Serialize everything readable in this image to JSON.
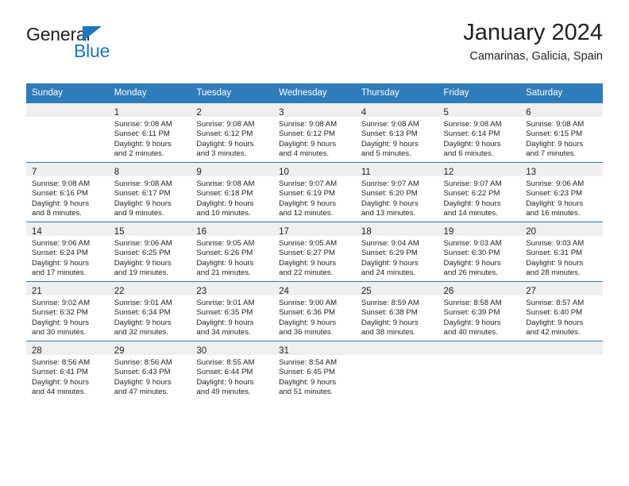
{
  "logo": {
    "word_one": "General",
    "word_two": "Blue",
    "triangle_icon": "blue-triangle-icon",
    "blue_hex": "#1f76bd"
  },
  "header": {
    "title": "January 2024",
    "subtitle": "Camarinas, Galicia, Spain"
  },
  "theme": {
    "header_blue": "#2e7cba",
    "daynum_band": "#efefef",
    "text": "#231f20"
  },
  "calendar": {
    "weekday_headers": [
      "Sunday",
      "Monday",
      "Tuesday",
      "Wednesday",
      "Thursday",
      "Friday",
      "Saturday"
    ],
    "weeks": [
      [
        {
          "day": "",
          "lines": []
        },
        {
          "day": "1",
          "lines": [
            "Sunrise: 9:08 AM",
            "Sunset: 6:11 PM",
            "Daylight: 9 hours",
            "and 2 minutes."
          ]
        },
        {
          "day": "2",
          "lines": [
            "Sunrise: 9:08 AM",
            "Sunset: 6:12 PM",
            "Daylight: 9 hours",
            "and 3 minutes."
          ]
        },
        {
          "day": "3",
          "lines": [
            "Sunrise: 9:08 AM",
            "Sunset: 6:12 PM",
            "Daylight: 9 hours",
            "and 4 minutes."
          ]
        },
        {
          "day": "4",
          "lines": [
            "Sunrise: 9:08 AM",
            "Sunset: 6:13 PM",
            "Daylight: 9 hours",
            "and 5 minutes."
          ]
        },
        {
          "day": "5",
          "lines": [
            "Sunrise: 9:08 AM",
            "Sunset: 6:14 PM",
            "Daylight: 9 hours",
            "and 6 minutes."
          ]
        },
        {
          "day": "6",
          "lines": [
            "Sunrise: 9:08 AM",
            "Sunset: 6:15 PM",
            "Daylight: 9 hours",
            "and 7 minutes."
          ]
        }
      ],
      [
        {
          "day": "7",
          "lines": [
            "Sunrise: 9:08 AM",
            "Sunset: 6:16 PM",
            "Daylight: 9 hours",
            "and 8 minutes."
          ]
        },
        {
          "day": "8",
          "lines": [
            "Sunrise: 9:08 AM",
            "Sunset: 6:17 PM",
            "Daylight: 9 hours",
            "and 9 minutes."
          ]
        },
        {
          "day": "9",
          "lines": [
            "Sunrise: 9:08 AM",
            "Sunset: 6:18 PM",
            "Daylight: 9 hours",
            "and 10 minutes."
          ]
        },
        {
          "day": "10",
          "lines": [
            "Sunrise: 9:07 AM",
            "Sunset: 6:19 PM",
            "Daylight: 9 hours",
            "and 12 minutes."
          ]
        },
        {
          "day": "11",
          "lines": [
            "Sunrise: 9:07 AM",
            "Sunset: 6:20 PM",
            "Daylight: 9 hours",
            "and 13 minutes."
          ]
        },
        {
          "day": "12",
          "lines": [
            "Sunrise: 9:07 AM",
            "Sunset: 6:22 PM",
            "Daylight: 9 hours",
            "and 14 minutes."
          ]
        },
        {
          "day": "13",
          "lines": [
            "Sunrise: 9:06 AM",
            "Sunset: 6:23 PM",
            "Daylight: 9 hours",
            "and 16 minutes."
          ]
        }
      ],
      [
        {
          "day": "14",
          "lines": [
            "Sunrise: 9:06 AM",
            "Sunset: 6:24 PM",
            "Daylight: 9 hours",
            "and 17 minutes."
          ]
        },
        {
          "day": "15",
          "lines": [
            "Sunrise: 9:06 AM",
            "Sunset: 6:25 PM",
            "Daylight: 9 hours",
            "and 19 minutes."
          ]
        },
        {
          "day": "16",
          "lines": [
            "Sunrise: 9:05 AM",
            "Sunset: 6:26 PM",
            "Daylight: 9 hours",
            "and 21 minutes."
          ]
        },
        {
          "day": "17",
          "lines": [
            "Sunrise: 9:05 AM",
            "Sunset: 6:27 PM",
            "Daylight: 9 hours",
            "and 22 minutes."
          ]
        },
        {
          "day": "18",
          "lines": [
            "Sunrise: 9:04 AM",
            "Sunset: 6:29 PM",
            "Daylight: 9 hours",
            "and 24 minutes."
          ]
        },
        {
          "day": "19",
          "lines": [
            "Sunrise: 9:03 AM",
            "Sunset: 6:30 PM",
            "Daylight: 9 hours",
            "and 26 minutes."
          ]
        },
        {
          "day": "20",
          "lines": [
            "Sunrise: 9:03 AM",
            "Sunset: 6:31 PM",
            "Daylight: 9 hours",
            "and 28 minutes."
          ]
        }
      ],
      [
        {
          "day": "21",
          "lines": [
            "Sunrise: 9:02 AM",
            "Sunset: 6:32 PM",
            "Daylight: 9 hours",
            "and 30 minutes."
          ]
        },
        {
          "day": "22",
          "lines": [
            "Sunrise: 9:01 AM",
            "Sunset: 6:34 PM",
            "Daylight: 9 hours",
            "and 32 minutes."
          ]
        },
        {
          "day": "23",
          "lines": [
            "Sunrise: 9:01 AM",
            "Sunset: 6:35 PM",
            "Daylight: 9 hours",
            "and 34 minutes."
          ]
        },
        {
          "day": "24",
          "lines": [
            "Sunrise: 9:00 AM",
            "Sunset: 6:36 PM",
            "Daylight: 9 hours",
            "and 36 minutes."
          ]
        },
        {
          "day": "25",
          "lines": [
            "Sunrise: 8:59 AM",
            "Sunset: 6:38 PM",
            "Daylight: 9 hours",
            "and 38 minutes."
          ]
        },
        {
          "day": "26",
          "lines": [
            "Sunrise: 8:58 AM",
            "Sunset: 6:39 PM",
            "Daylight: 9 hours",
            "and 40 minutes."
          ]
        },
        {
          "day": "27",
          "lines": [
            "Sunrise: 8:57 AM",
            "Sunset: 6:40 PM",
            "Daylight: 9 hours",
            "and 42 minutes."
          ]
        }
      ],
      [
        {
          "day": "28",
          "lines": [
            "Sunrise: 8:56 AM",
            "Sunset: 6:41 PM",
            "Daylight: 9 hours",
            "and 44 minutes."
          ]
        },
        {
          "day": "29",
          "lines": [
            "Sunrise: 8:56 AM",
            "Sunset: 6:43 PM",
            "Daylight: 9 hours",
            "and 47 minutes."
          ]
        },
        {
          "day": "30",
          "lines": [
            "Sunrise: 8:55 AM",
            "Sunset: 6:44 PM",
            "Daylight: 9 hours",
            "and 49 minutes."
          ]
        },
        {
          "day": "31",
          "lines": [
            "Sunrise: 8:54 AM",
            "Sunset: 6:45 PM",
            "Daylight: 9 hours",
            "and 51 minutes."
          ]
        },
        {
          "day": "",
          "lines": []
        },
        {
          "day": "",
          "lines": []
        },
        {
          "day": "",
          "lines": []
        }
      ]
    ]
  }
}
